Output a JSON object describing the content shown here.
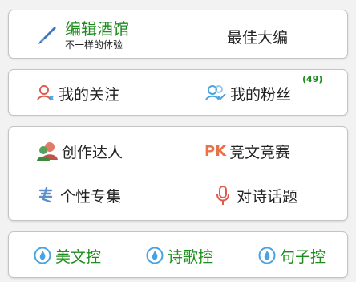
{
  "card1": {
    "title": "编辑酒馆",
    "subtitle": "不一样的体验",
    "right_label": "最佳大编"
  },
  "card2": {
    "follow_label": "我的关注",
    "fans_label": "我的粉丝",
    "fans_count": "(49)"
  },
  "card3": {
    "creator_label": "创作达人",
    "pk_badge": "PK",
    "contest_label": "竞文竞赛",
    "collection_label": "个性专集",
    "topic_label": "对诗话题"
  },
  "card4": {
    "items": [
      {
        "label": "美文控",
        "icon": "flame-icon"
      },
      {
        "label": "诗歌控",
        "icon": "flame-icon"
      },
      {
        "label": "句子控",
        "icon": "flame-icon"
      }
    ]
  },
  "colors": {
    "accent_green": "#1e8c1e",
    "icon_blue": "#4aa3e0",
    "icon_red": "#e05a4f",
    "pk_orange": "#e8734a"
  }
}
